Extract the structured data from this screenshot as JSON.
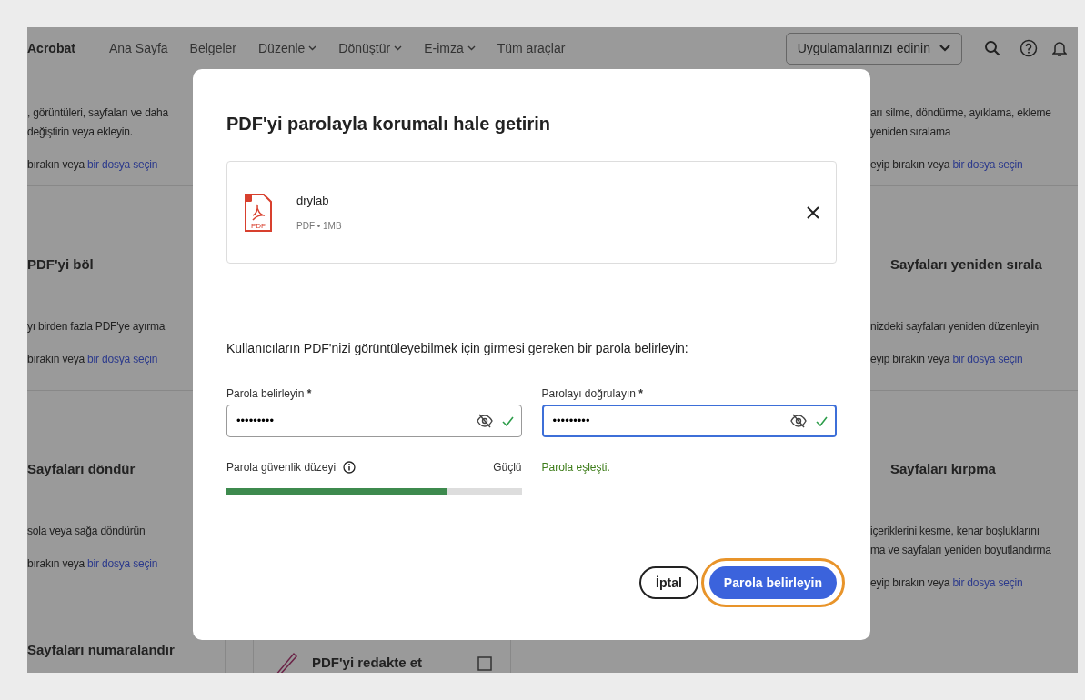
{
  "app_bar": {
    "brand": "Acrobat",
    "nav": [
      {
        "label": "Ana Sayfa",
        "dropdown": false
      },
      {
        "label": "Belgeler",
        "dropdown": false
      },
      {
        "label": "Düzenle",
        "dropdown": true
      },
      {
        "label": "Dönüştür",
        "dropdown": true
      },
      {
        "label": "E-imza",
        "dropdown": true
      },
      {
        "label": "Tüm araçlar",
        "dropdown": false
      }
    ],
    "apps_button": "Uygulamalarınızı edinin"
  },
  "background_tools": {
    "left": [
      {
        "description": [
          ", görüntüleri, sayfaları ve daha",
          "değiştirin veya ekleyin."
        ],
        "hint": "bırakın veya",
        "link": "bir dosya seçin"
      },
      {
        "title": "PDF'yi böl",
        "description": [
          "yı birden fazla PDF'ye ayırma"
        ],
        "hint": "bırakın veya",
        "link": "bir dosya seçin"
      },
      {
        "title": "Sayfaları döndür",
        "description": [
          "sola veya sağa döndürün"
        ],
        "hint": "bırakın veya",
        "link": "bir dosya seçin"
      },
      {
        "title": "Sayfaları numaralandır"
      }
    ],
    "middle": [
      {
        "title": "PDF'yi redakte et"
      }
    ],
    "right": [
      {
        "description": [
          "arı silme, döndürme, ayıklama, ekleme",
          "yeniden sıralama"
        ],
        "hint": "eyip bırakın veya",
        "link": "bir dosya seçin"
      },
      {
        "title": "Sayfaları yeniden sırala",
        "description": [
          "nizdeki sayfaları yeniden düzenleyin"
        ],
        "hint": "eyip bırakın veya",
        "link": "bir dosya seçin"
      },
      {
        "title": "Sayfaları kırpma",
        "description": [
          "içeriklerini kesme, kenar boşluklarını",
          "ma ve sayfaları yeniden boyutlandırma"
        ],
        "hint": "eyip bırakın veya",
        "link": "bir dosya seçin"
      }
    ]
  },
  "dialog": {
    "title": "PDF'yi parolayla korumalı hale getirin",
    "file": {
      "name": "drylab",
      "meta": "PDF • 1MB",
      "icon_label": "PDF"
    },
    "instruction": "Kullanıcıların PDF'nizi görüntüleyebilmek için girmesi gereken bir parola belirleyin:",
    "fields": [
      {
        "label": "Parola belirleyin",
        "required_mark": "*",
        "value": "•••••••••",
        "valid": true,
        "focused": false
      },
      {
        "label": "Parolayı doğrulayın",
        "required_mark": "*",
        "value": "•••••••••",
        "valid": true,
        "focused": true
      }
    ],
    "strength": {
      "label": "Parola güvenlik düzeyi",
      "rating": "Güçlü",
      "level": 0.75
    },
    "match_message": "Parola eşleşti.",
    "buttons": [
      {
        "label": "İptal",
        "kind": "secondary",
        "highlighted": false
      },
      {
        "label": "Parola belirleyin",
        "kind": "primary",
        "highlighted": true
      }
    ]
  }
}
